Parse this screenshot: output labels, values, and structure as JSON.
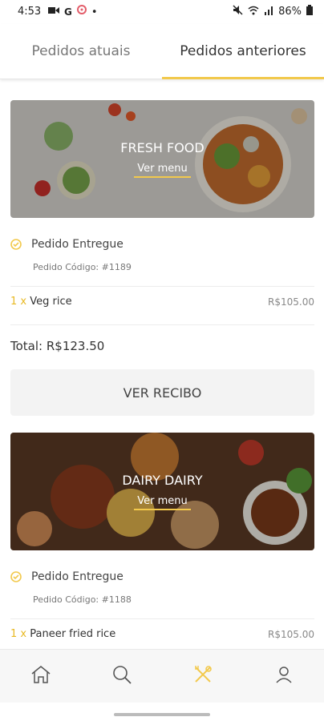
{
  "status_bar": {
    "time": "4:53",
    "battery_text": "86%",
    "left_icons": [
      "video-icon",
      "g-icon",
      "location-icon",
      "dot-icon"
    ],
    "right_icons": [
      "mute-icon",
      "wifi-icon",
      "signal-icon",
      "battery-icon"
    ]
  },
  "tabs": [
    {
      "label": "Pedidos atuais",
      "active": false
    },
    {
      "label": "Pedidos anteriores",
      "active": true
    }
  ],
  "orders": [
    {
      "restaurant": "FRESH FOOD",
      "link": "Ver menu",
      "status": "Pedido Entregue",
      "code": "Pedido Código: #1189",
      "items": [
        {
          "qty": "1 x",
          "name": "Veg rice",
          "price": "R$105.00"
        }
      ],
      "total": "Total: R$123.50",
      "button": "VER RECIBO"
    },
    {
      "restaurant": "DAIRY DAIRY",
      "link": "Ver menu",
      "status": "Pedido Entregue",
      "code": "Pedido Código: #1188",
      "items": [
        {
          "qty": "1 x",
          "name": "Paneer fried rice",
          "price": "R$105.00"
        }
      ]
    }
  ],
  "bottom_nav": [
    {
      "icon": "home-icon",
      "active": false
    },
    {
      "icon": "search-icon",
      "active": false
    },
    {
      "icon": "fork-spoon-icon",
      "active": true
    },
    {
      "icon": "profile-icon",
      "active": false
    }
  ],
  "colors": {
    "accent": "#f2c94c"
  }
}
